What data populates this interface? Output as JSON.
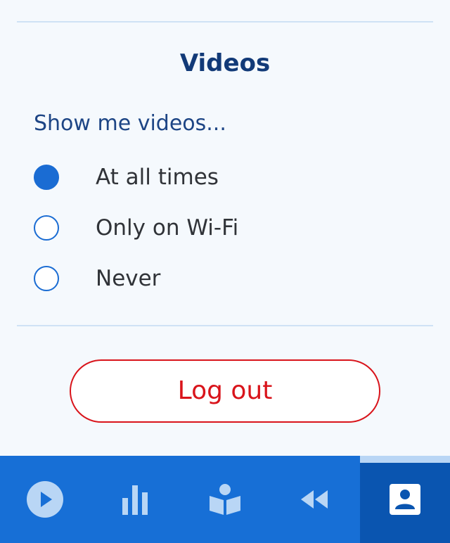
{
  "videos_section": {
    "title": "Videos",
    "prompt": "Show me videos...",
    "options": [
      {
        "label": "At all times",
        "selected": true
      },
      {
        "label": "Only on Wi-Fi",
        "selected": false
      },
      {
        "label": "Never",
        "selected": false
      }
    ]
  },
  "logout": {
    "label": "Log out"
  },
  "tabbar": {
    "tabs": [
      {
        "icon": "play-circle-icon",
        "active": false
      },
      {
        "icon": "bar-chart-icon",
        "active": false
      },
      {
        "icon": "reading-icon",
        "active": false
      },
      {
        "icon": "rewind-icon",
        "active": false
      },
      {
        "icon": "profile-icon",
        "active": true
      }
    ]
  },
  "colors": {
    "accent": "#1a6cd3",
    "tabbar": "#176fd6",
    "tabbar_active": "#0a55b0",
    "danger": "#d9141b",
    "title": "#123a78"
  }
}
